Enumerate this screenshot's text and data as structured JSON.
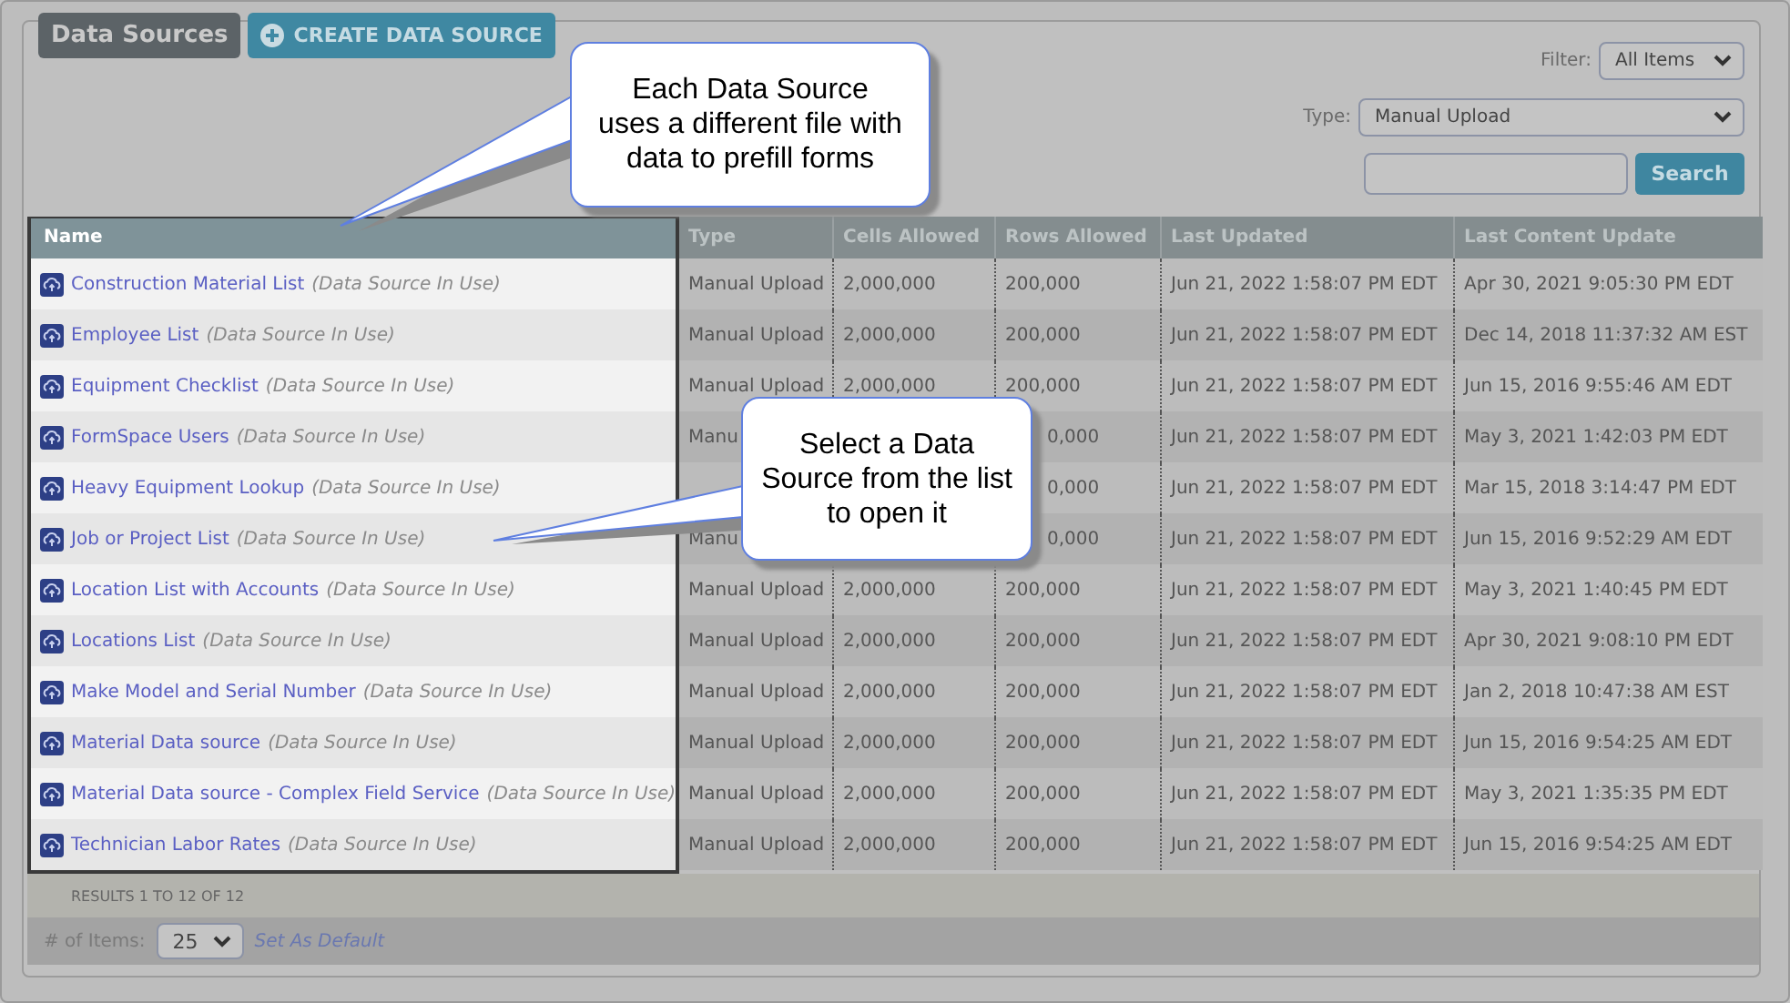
{
  "header": {
    "title": "Data Sources",
    "create_button": "CREATE DATA SOURCE"
  },
  "filters": {
    "filter_label": "Filter:",
    "filter_value": "All Items",
    "type_label": "Type:",
    "type_value": "Manual Upload",
    "search_button": "Search"
  },
  "table": {
    "columns": [
      "Name",
      "Type",
      "Cells Allowed",
      "Rows Allowed",
      "Last Updated",
      "Last Content Update"
    ],
    "rows": [
      {
        "name": "Construction Material List",
        "note": "(Data Source In Use)",
        "type": "Manual Upload",
        "cells": "2,000,000",
        "rows": "200,000",
        "last_updated": "Jun 21, 2022 1:58:07 PM EDT",
        "last_content_update": "Apr 30, 2021 9:05:30 PM EDT"
      },
      {
        "name": "Employee List",
        "note": "(Data Source In Use)",
        "type": "Manual Upload",
        "cells": "2,000,000",
        "rows": "200,000",
        "last_updated": "Jun 21, 2022 1:58:07 PM EDT",
        "last_content_update": "Dec 14, 2018 11:37:32 AM EST"
      },
      {
        "name": "Equipment Checklist",
        "note": "(Data Source In Use)",
        "type": "Manual Upload",
        "cells": "2,000,000",
        "rows": "200,000",
        "last_updated": "Jun 21, 2022 1:58:07 PM EDT",
        "last_content_update": "Jun 15, 2016 9:55:46 AM EDT"
      },
      {
        "name": "FormSpace Users",
        "note": "(Data Source In Use)",
        "covered": true,
        "type": "Manu",
        "cells": "",
        "rows": "0,000",
        "last_updated": "Jun 21, 2022 1:58:07 PM EDT",
        "last_content_update": "May 3, 2021 1:42:03 PM EDT"
      },
      {
        "name": "Heavy Equipment Lookup",
        "note": "(Data Source In Use)",
        "covered": true,
        "type": "",
        "cells": "",
        "rows": "0,000",
        "last_updated": "Jun 21, 2022 1:58:07 PM EDT",
        "last_content_update": "Mar 15, 2018 3:14:47 PM EDT"
      },
      {
        "name": "Job or Project List",
        "note": "(Data Source In Use)",
        "covered": true,
        "type": "Manu",
        "cells": "",
        "rows": "0,000",
        "last_updated": "Jun 21, 2022 1:58:07 PM EDT",
        "last_content_update": "Jun 15, 2016 9:52:29 AM EDT"
      },
      {
        "name": "Location List with Accounts",
        "note": "(Data Source In Use)",
        "type": "Manual Upload",
        "cells": "2,000,000",
        "rows": "200,000",
        "last_updated": "Jun 21, 2022 1:58:07 PM EDT",
        "last_content_update": "May 3, 2021 1:40:45 PM EDT"
      },
      {
        "name": "Locations List",
        "note": "(Data Source In Use)",
        "type": "Manual Upload",
        "cells": "2,000,000",
        "rows": "200,000",
        "last_updated": "Jun 21, 2022 1:58:07 PM EDT",
        "last_content_update": "Apr 30, 2021 9:08:10 PM EDT"
      },
      {
        "name": "Make Model and Serial Number",
        "note": "(Data Source In Use)",
        "type": "Manual Upload",
        "cells": "2,000,000",
        "rows": "200,000",
        "last_updated": "Jun 21, 2022 1:58:07 PM EDT",
        "last_content_update": "Jan 2, 2018 10:47:38 AM EST"
      },
      {
        "name": "Material Data source",
        "note": "(Data Source In Use)",
        "type": "Manual Upload",
        "cells": "2,000,000",
        "rows": "200,000",
        "last_updated": "Jun 21, 2022 1:58:07 PM EDT",
        "last_content_update": "Jun 15, 2016 9:54:25 AM EDT"
      },
      {
        "name": "Material Data source - Complex Field Service",
        "note": "(Data Source In Use)",
        "type": "Manual Upload",
        "cells": "2,000,000",
        "rows": "200,000",
        "last_updated": "Jun 21, 2022 1:58:07 PM EDT",
        "last_content_update": "May 3, 2021 1:35:35 PM EDT"
      },
      {
        "name": "Technician Labor Rates",
        "note": "(Data Source In Use)",
        "type": "Manual Upload",
        "cells": "2,000,000",
        "rows": "200,000",
        "last_updated": "Jun 21, 2022 1:58:07 PM EDT",
        "last_content_update": "Jun 15, 2016 9:54:25 AM EDT"
      }
    ]
  },
  "results": "RESULTS 1 TO 12 OF 12",
  "footer": {
    "items_label": "# of Items:",
    "items_value": "25",
    "set_default": "Set As Default"
  },
  "callouts": [
    {
      "text": "Each Data Source uses a different file with data to prefill forms"
    },
    {
      "text": "Select a Data Source from the list to open it"
    }
  ]
}
